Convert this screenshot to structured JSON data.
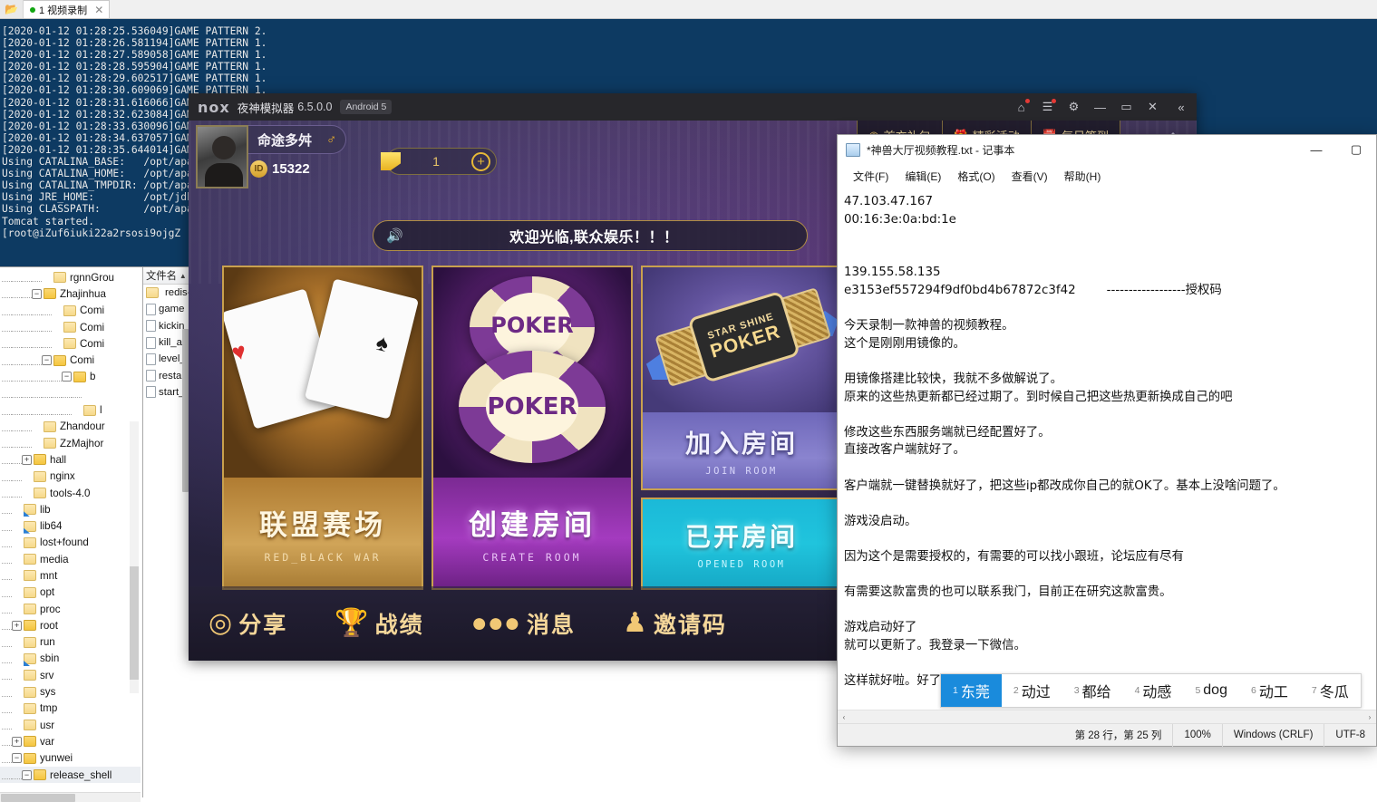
{
  "terminal": {
    "tab": {
      "label": "1 视频录制",
      "dot_color": "#12a612",
      "close": "✕"
    },
    "open_icon": "folder-open-icon",
    "log": "[2020-01-12 01:28:25.536049]GAME PATTERN 2.\n[2020-01-12 01:28:26.581194]GAME PATTERN 1.\n[2020-01-12 01:28:27.589058]GAME PATTERN 1.\n[2020-01-12 01:28:28.595904]GAME PATTERN 1.\n[2020-01-12 01:28:29.602517]GAME PATTERN 1.\n[2020-01-12 01:28:30.609069]GAME PATTERN 1.\n[2020-01-12 01:28:31.616066]GAME\n[2020-01-12 01:28:32.623084]GAME\n[2020-01-12 01:28:33.630096]GAME\n[2020-01-12 01:28:34.637057]GAME\n[2020-01-12 01:28:35.644014]GAME\nUsing CATALINA_BASE:   /opt/apach\nUsing CATALINA_HOME:   /opt/apach\nUsing CATALINA_TMPDIR: /opt/apach\nUsing JRE_HOME:        /opt/jdk1.\nUsing CLASSPATH:       /opt/apach\nTomcat started.\n[root@iZuf6iuki22a2rsosi9ojgZ rel"
  },
  "file_explorer": {
    "tree": [
      {
        "label": "rgnnGrou",
        "indent": 4,
        "expander": "",
        "kind": "folder",
        "clipped": true
      },
      {
        "label": "Zhajinhua",
        "indent": 3,
        "expander": "−",
        "kind": "folder-open"
      },
      {
        "label": "Comi",
        "indent": 5,
        "expander": "",
        "kind": "folder"
      },
      {
        "label": "Comi",
        "indent": 5,
        "expander": "",
        "kind": "folder"
      },
      {
        "label": "Comi",
        "indent": 5,
        "expander": "",
        "kind": "folder"
      },
      {
        "label": "Comi",
        "indent": 4,
        "expander": "−",
        "kind": "folder-open"
      },
      {
        "label": "b",
        "indent": 6,
        "expander": "−",
        "kind": "folder-open"
      },
      {
        "label": "",
        "indent": 8,
        "expander": "",
        "kind": "none"
      },
      {
        "label": "l",
        "indent": 7,
        "expander": "",
        "kind": "folder"
      },
      {
        "label": "Zhandour",
        "indent": 3,
        "expander": "",
        "kind": "folder"
      },
      {
        "label": "ZzMajhor",
        "indent": 3,
        "expander": "",
        "kind": "folder"
      },
      {
        "label": "hall",
        "indent": 2,
        "expander": "+",
        "kind": "folder-open"
      },
      {
        "label": "nginx",
        "indent": 2,
        "expander": "",
        "kind": "folder"
      },
      {
        "label": "tools-4.0",
        "indent": 2,
        "expander": "",
        "kind": "folder"
      },
      {
        "label": "lib",
        "indent": 1,
        "expander": "",
        "kind": "folder-link"
      },
      {
        "label": "lib64",
        "indent": 1,
        "expander": "",
        "kind": "folder-link"
      },
      {
        "label": "lost+found",
        "indent": 1,
        "expander": "",
        "kind": "folder"
      },
      {
        "label": "media",
        "indent": 1,
        "expander": "",
        "kind": "folder"
      },
      {
        "label": "mnt",
        "indent": 1,
        "expander": "",
        "kind": "folder"
      },
      {
        "label": "opt",
        "indent": 1,
        "expander": "",
        "kind": "folder"
      },
      {
        "label": "proc",
        "indent": 1,
        "expander": "",
        "kind": "folder"
      },
      {
        "label": "root",
        "indent": 1,
        "expander": "+",
        "kind": "folder-open"
      },
      {
        "label": "run",
        "indent": 1,
        "expander": "",
        "kind": "folder"
      },
      {
        "label": "sbin",
        "indent": 1,
        "expander": "",
        "kind": "folder-link"
      },
      {
        "label": "srv",
        "indent": 1,
        "expander": "",
        "kind": "folder"
      },
      {
        "label": "sys",
        "indent": 1,
        "expander": "",
        "kind": "folder"
      },
      {
        "label": "tmp",
        "indent": 1,
        "expander": "",
        "kind": "folder"
      },
      {
        "label": "usr",
        "indent": 1,
        "expander": "",
        "kind": "folder"
      },
      {
        "label": "var",
        "indent": 1,
        "expander": "+",
        "kind": "folder-open"
      },
      {
        "label": "yunwei",
        "indent": 1,
        "expander": "−",
        "kind": "folder-open"
      },
      {
        "label": "release_shell",
        "indent": 2,
        "expander": "−",
        "kind": "folder-open",
        "selected": true
      }
    ],
    "list_header": "文件名",
    "sort_arrow": "▲",
    "files": [
      {
        "name": "redis-",
        "kind": "folder"
      },
      {
        "name": "game",
        "kind": "file"
      },
      {
        "name": "kickin",
        "kind": "file"
      },
      {
        "name": "kill_all",
        "kind": "file"
      },
      {
        "name": "level_s",
        "kind": "file"
      },
      {
        "name": "restar",
        "kind": "file"
      },
      {
        "name": "start_a",
        "kind": "file"
      }
    ]
  },
  "nox": {
    "logo": "nox",
    "title": "夜神模拟器",
    "version": "6.5.0.0",
    "android_badge": "Android 5",
    "controls": [
      {
        "name": "shirt-icon",
        "glyph": "⌂",
        "badge": true
      },
      {
        "name": "menu-icon",
        "glyph": "☰",
        "badge": true
      },
      {
        "name": "gear-icon",
        "glyph": "⚙",
        "badge": false
      },
      {
        "name": "minimize-icon",
        "glyph": "—",
        "badge": false
      },
      {
        "name": "maximize-icon",
        "glyph": "▭",
        "badge": false
      },
      {
        "name": "close-icon",
        "glyph": "✕",
        "badge": false
      },
      {
        "name": "collapse-icon",
        "glyph": "«",
        "badge": false
      }
    ]
  },
  "game": {
    "player": {
      "name": "命途多舛",
      "gender_icon": "♂",
      "id_label": "ID",
      "id_value": "15322"
    },
    "currency": {
      "icon": "gold-coin-icon",
      "value": "1",
      "add": "+"
    },
    "tabs": [
      {
        "icon": "coin-icon",
        "label": "首充礼包"
      },
      {
        "icon": "gift-icon",
        "label": "精彩活动"
      },
      {
        "icon": "calendar-icon",
        "label": "每日签到"
      }
    ],
    "diamond_button": "◈",
    "marquee": {
      "icon": "speaker-icon",
      "text": "欢迎光临,联众娱乐！！！"
    },
    "cards": [
      {
        "cn": "联盟赛场",
        "en": "RED_BLACK WAR",
        "art": "playing-cards"
      },
      {
        "cn": "创建房间",
        "en": "CREATE ROOM",
        "art": "poker-chips",
        "chip_text": "POKER"
      },
      {
        "cn": "加入房间",
        "en": "JOIN ROOM",
        "art": "star-shine-poker-watch",
        "watch_l1": "STAR SHINE",
        "watch_l2": "POKER"
      },
      {
        "cn": "已开房间",
        "en": "OPENED ROOM",
        "art": "aces"
      }
    ],
    "bottom_bar": [
      {
        "icon": "share-icon",
        "glyph": "◎",
        "label": "分享"
      },
      {
        "icon": "trophy-icon",
        "glyph": "🏆",
        "label": "战绩"
      },
      {
        "icon": "message-icon",
        "glyph": "●●●",
        "label": "消息"
      },
      {
        "icon": "invite-icon",
        "glyph": "♟",
        "label": "邀请码"
      }
    ]
  },
  "notepad": {
    "title": "*神兽大厅视频教程.txt - 记事本",
    "window_buttons": [
      {
        "name": "minimize-button",
        "glyph": "—"
      },
      {
        "name": "maximize-button",
        "glyph": "▢"
      }
    ],
    "menus": [
      "文件(F)",
      "编辑(E)",
      "格式(O)",
      "查看(V)",
      "帮助(H)"
    ],
    "content": "47.103.47.167\n00:16:3e:0a:bd:1e\n\n\n139.155.58.135\ne3153ef557294f9df0bd4b67872c3f42        ------------------授权码\n\n今天录制一款神兽的视频教程。\n这个是刚刚用镜像的。\n\n用镜像搭建比较快，我就不多做解说了。\n原来的这些热更新都已经过期了。到时候自己把这些热更新换成自己的吧\n\n修改这些东西服务端就已经配置好了。\n直接改客户端就好了。\n\n客户端就一键替换就好了，把这些ip都改成你自己的就OK了。基本上没啥问题了。\n\n游戏没启动。\n\n因为这个是需要授权的，有需要的可以找小跟班，论坛应有尽有\n\n有需要这款富贵的也可以联系我门，目前正在研究这款富贵。\n\n游戏启动好了\n就可以更新了。我登录一下微信。\n\n这样就好啦。好了。录制就到此结束了。我要研究其他do'g",
    "ime_candidates": [
      {
        "index": "1",
        "word": "东莞",
        "active": true
      },
      {
        "index": "2",
        "word": "动过",
        "active": false
      },
      {
        "index": "3",
        "word": "都给",
        "active": false
      },
      {
        "index": "4",
        "word": "动感",
        "active": false
      },
      {
        "index": "5",
        "word": "dog",
        "active": false
      },
      {
        "index": "6",
        "word": "动工",
        "active": false
      },
      {
        "index": "7",
        "word": "冬瓜",
        "active": false
      }
    ],
    "hscroll": {
      "left_arrow": "‹",
      "right_arrow": "›"
    },
    "status": [
      "第 28 行，第 25 列",
      "100%",
      "Windows (CRLF)",
      "UTF-8"
    ]
  },
  "colors": {
    "terminal_bg": "#0d3a62",
    "ime_accent": "#1a8bdc",
    "gold": "#e7b937",
    "nox_bg": "#27272b"
  }
}
